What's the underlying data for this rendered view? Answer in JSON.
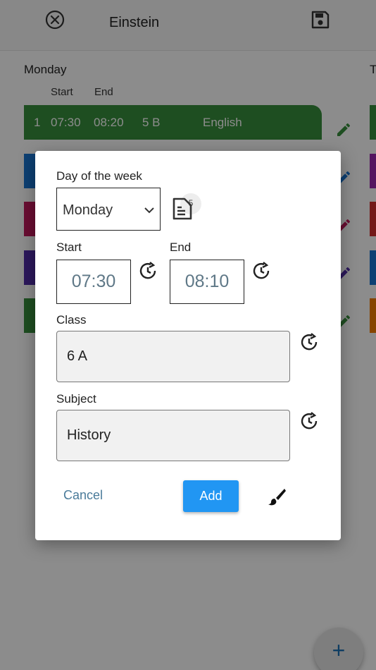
{
  "appbar": {
    "title": "Einstein",
    "close_icon": "close-circle-icon",
    "save_icon": "save-icon"
  },
  "schedule": {
    "day": "Monday",
    "next_day_initial": "T",
    "columns": {
      "start": "Start",
      "end": "End"
    },
    "first_lesson": {
      "num": "1",
      "start": "07:30",
      "end": "08:20",
      "class": "5 B",
      "subject": "English",
      "color": "#388e3c"
    },
    "strip_colors": [
      "#1976d2",
      "#c2185b",
      "#512da8",
      "#388e3c"
    ],
    "right_strip_colors": [
      "#388e3c",
      "#9c27b0",
      "#d32f2f",
      "#1976d2",
      "#f57c00"
    ]
  },
  "dialog": {
    "day_label": "Day of the week",
    "day_value": "Monday",
    "lesson_count_badge": "5",
    "start_label": "Start",
    "start_value": "07:30",
    "end_label": "End",
    "end_value": "08:10",
    "class_label": "Class",
    "class_value": "6 A",
    "subject_label": "Subject",
    "subject_value": "History",
    "cancel_label": "Cancel",
    "add_label": "Add"
  },
  "fab": {
    "label": "+"
  },
  "colors": {
    "accent": "#2196f3",
    "time_text": "#5f7887",
    "cancel_text": "#4a7b9a"
  }
}
